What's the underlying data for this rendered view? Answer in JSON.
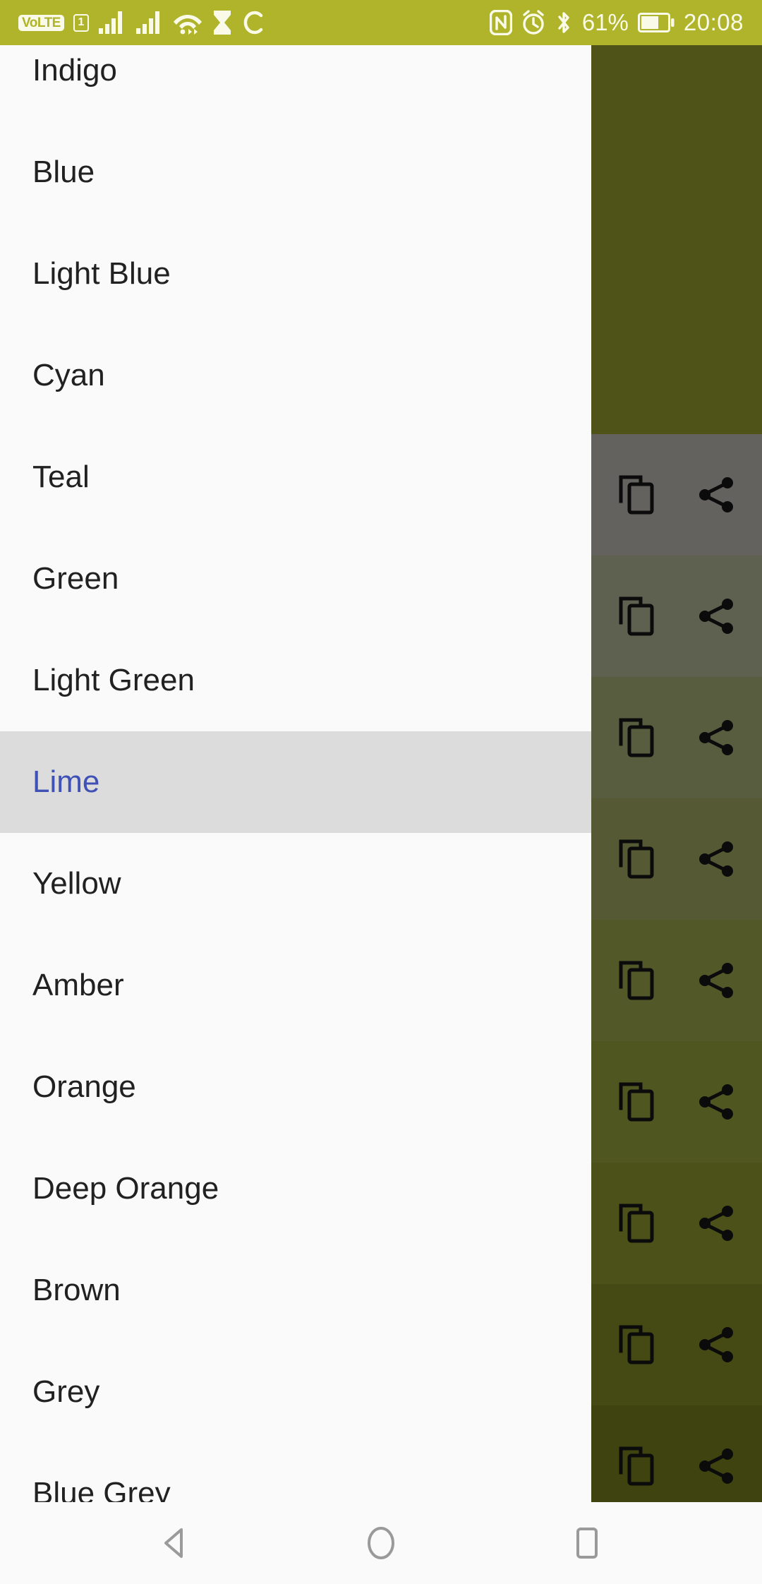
{
  "status_bar": {
    "background": "#AFB42B",
    "foreground": "#FAFAE8",
    "volte_label": "VoLTE",
    "sim_label": "1",
    "icons_left": [
      "volte-icon",
      "sim1-icon",
      "signal-bars-1-icon",
      "signal-bars-2-icon",
      "wifi-icon",
      "hourglass-icon",
      "sync-icon"
    ],
    "icons_right": [
      "nfc-icon",
      "alarm-icon",
      "bluetooth-icon"
    ],
    "battery_percent": "61%",
    "battery_icon": "battery-icon",
    "clock": "20:08"
  },
  "list": {
    "background": "#FAFAFA",
    "text_color": "#212121",
    "selected_background": "#DCDCDC",
    "selected_text_color": "#3F51B5",
    "selected_index": 7,
    "items": [
      {
        "label": "Indigo"
      },
      {
        "label": "Blue"
      },
      {
        "label": "Light Blue"
      },
      {
        "label": "Cyan"
      },
      {
        "label": "Teal"
      },
      {
        "label": "Green"
      },
      {
        "label": "Light Green"
      },
      {
        "label": "Lime"
      },
      {
        "label": "Yellow"
      },
      {
        "label": "Amber"
      },
      {
        "label": "Orange"
      },
      {
        "label": "Deep Orange"
      },
      {
        "label": "Brown"
      },
      {
        "label": "Grey"
      },
      {
        "label": "Blue Grey"
      }
    ]
  },
  "right_panel": {
    "header_color": "#4F5318",
    "copy_icon": "copy-icon",
    "share_icon": "share-icon",
    "rows": [
      {
        "swatch": "#63625E"
      },
      {
        "swatch": "#5E6050"
      },
      {
        "swatch": "#595D3F"
      },
      {
        "swatch": "#565A34"
      },
      {
        "swatch": "#535828"
      },
      {
        "swatch": "#4F5620"
      },
      {
        "swatch": "#4B5118"
      },
      {
        "swatch": "#454A14"
      },
      {
        "swatch": "#3E4310"
      }
    ]
  },
  "nav_bar": {
    "background": "#FAFAFA",
    "icon_color": "#9A9A9A",
    "buttons": [
      {
        "name": "back-button",
        "icon": "triangle-left-icon"
      },
      {
        "name": "home-button",
        "icon": "circle-icon"
      },
      {
        "name": "recents-button",
        "icon": "square-icon"
      }
    ]
  }
}
